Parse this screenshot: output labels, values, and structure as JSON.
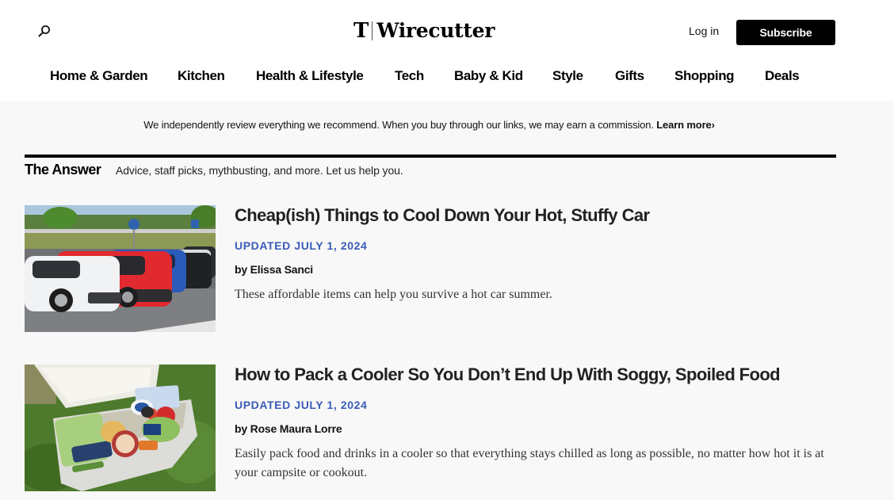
{
  "header": {
    "search_icon": "search-icon",
    "logo": {
      "mark": "T",
      "wordmark": "Wirecutter"
    },
    "login_label": "Log in",
    "subscribe_label": "Subscribe"
  },
  "nav": {
    "items": [
      {
        "label": "Home & Garden"
      },
      {
        "label": "Kitchen"
      },
      {
        "label": "Health & Lifestyle"
      },
      {
        "label": "Tech"
      },
      {
        "label": "Baby & Kid"
      },
      {
        "label": "Style"
      },
      {
        "label": "Gifts"
      },
      {
        "label": "Shopping"
      },
      {
        "label": "Deals"
      }
    ]
  },
  "disclosure": {
    "text": "We independently review everything we recommend. When you buy through our links, we may earn a commission.",
    "link_label": "Learn more",
    "link_icon": "›"
  },
  "section": {
    "title": "The Answer",
    "description": "Advice, staff picks, mythbusting, and more. Let us help you."
  },
  "articles": [
    {
      "title": "Cheap(ish) Things to Cool Down Your Hot, Stuffy Car",
      "date": "UPDATED JULY 1, 2024",
      "byline_prefix": "by",
      "author": "Elissa Sanci",
      "description": "These affordable items can help you survive a hot car summer.",
      "image_alt": "Cars parked in a sunny parking lot"
    },
    {
      "title": "How to Pack a Cooler So You Don’t End Up With Soggy, Spoiled Food",
      "date": "UPDATED JULY 1, 2024",
      "byline_prefix": "by",
      "author": "Rose Maura Lorre",
      "description": "Easily pack food and drinks in a cooler so that everything stays chilled as long as possible, no matter how hot it is at your campsite or cookout.",
      "image_alt": "Open white cooler packed with food on grass"
    }
  ],
  "colors": {
    "accent_date": "#3a5bb8",
    "subscribe_bg": "#000000",
    "page_bg": "#f8f8f8"
  }
}
